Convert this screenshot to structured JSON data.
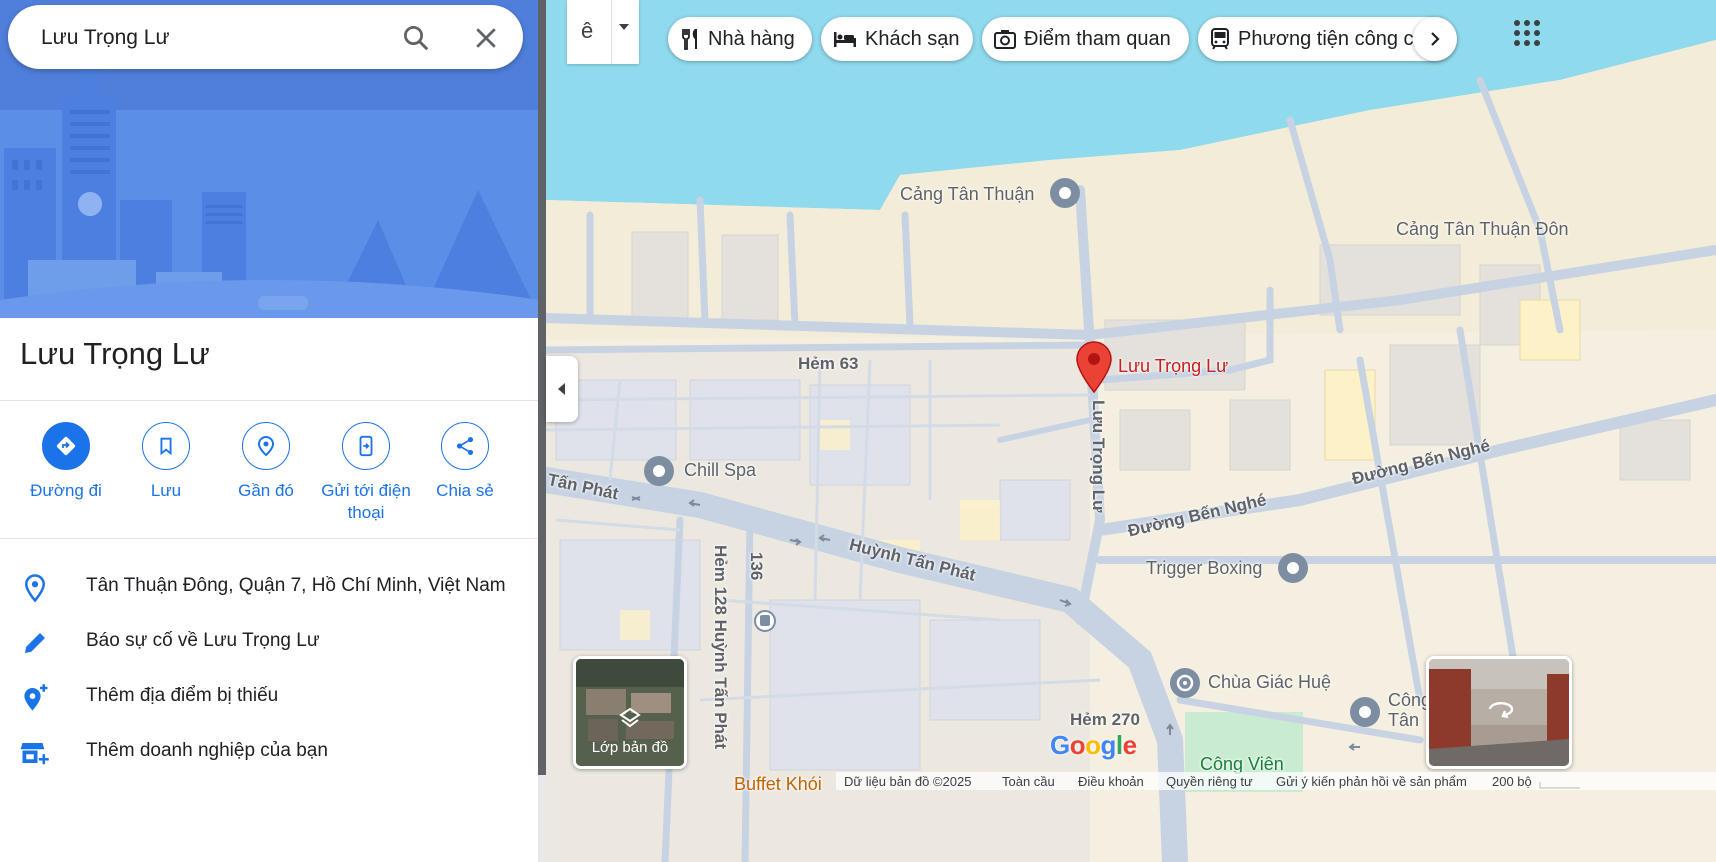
{
  "search": {
    "query": "Lưu Trọng Lư"
  },
  "place": {
    "name": "Lưu Trọng Lư"
  },
  "actions": [
    {
      "label": "Đường đi"
    },
    {
      "label": "Lưu"
    },
    {
      "label": "Gần đó"
    },
    {
      "label": "Gửi tới điện thoại"
    },
    {
      "label": "Chia sẻ"
    }
  ],
  "info": {
    "address": "Tân Thuận Đông, Quận 7, Hồ Chí Minh, Việt Nam",
    "report": "Báo sự cố về Lưu Trọng Lư",
    "add_place": "Thêm địa điểm bị thiếu",
    "add_business": "Thêm doanh nghiệp của bạn"
  },
  "language_button": {
    "glyph": "ê"
  },
  "chips": [
    {
      "label": "Nhà hàng",
      "icon": "fork-knife-icon"
    },
    {
      "label": "Khách sạn",
      "icon": "bed-icon"
    },
    {
      "label": "Điểm tham quan",
      "icon": "camera-icon"
    },
    {
      "label": "Phương tiện công cộng",
      "icon": "transit-icon"
    }
  ],
  "map": {
    "pin_label": "Lưu Trọng Lư",
    "labels": {
      "port1": "Cảng Tân Thuận",
      "port2": "Cảng Tân Thuận Đôn",
      "hem63": "Hẻm 63",
      "chill_spa": "Chill Spa",
      "tan_phat": "Tấn Phát",
      "huynh_tan_phat": "Huỳnh Tấn Phát",
      "luu_trong_lu_road": "Lưu Trọng Lư",
      "ben_nghe1": "Đường Bến Nghé",
      "ben_nghe2": "Đường Bến Nghé",
      "trigger_boxing": "Trigger Boxing",
      "chua_giac_hue": "Chùa Giác Huệ",
      "hem270": "Hẻm 270",
      "hem128": "Hẻm 128 Huỳnh Tấn Phát",
      "r136": "136",
      "cong_tan": "Công\nTân",
      "cong_vien": "Công Viên",
      "buffet": "Buffet Khói"
    },
    "layers_label": "Lớp bản đồ",
    "logo_letters": [
      "G",
      "o",
      "o",
      "g",
      "l",
      "e"
    ],
    "logo_colors": [
      "#4285F4",
      "#EA4335",
      "#FBBC05",
      "#4285F4",
      "#34A853",
      "#EA4335"
    ]
  },
  "footer": {
    "data": "Dữ liệu bản đồ ©2025",
    "global": "Toàn cầu",
    "terms": "Điều khoản",
    "privacy": "Quyền riêng tư",
    "feedback": "Gửi ý kiến phản hồi về sản phẩm",
    "scale": "200 bộ"
  },
  "colors": {
    "accent": "#1a73e8",
    "water": "#90daee",
    "pin": "#ea4335"
  }
}
